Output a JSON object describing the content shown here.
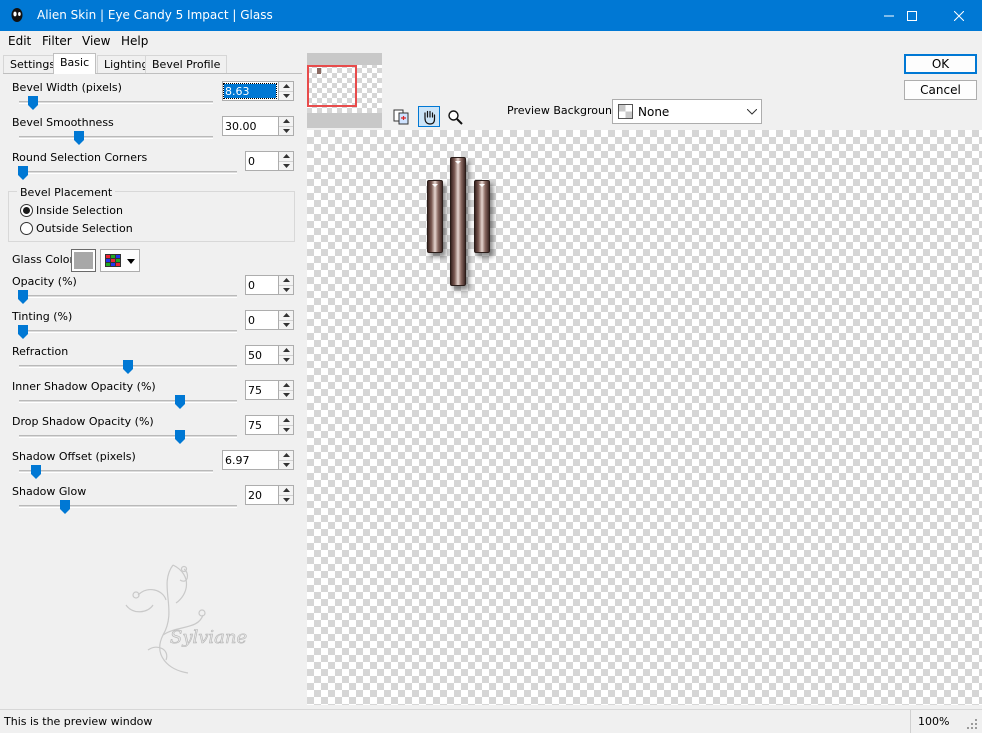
{
  "window": {
    "title": "Alien Skin | Eye Candy 5 Impact | Glass"
  },
  "menu": [
    "Edit",
    "Filter",
    "View",
    "Help"
  ],
  "tabs": [
    "Settings",
    "Basic",
    "Lighting",
    "Bevel Profile"
  ],
  "active_tab": "Basic",
  "controls": {
    "bevel_width": {
      "label": "Bevel Width (pixels)",
      "value": "8.63",
      "slider_fraction": 0.1
    },
    "bevel_smoothness": {
      "label": "Bevel Smoothness",
      "value": "30.00",
      "slider_fraction": 0.3
    },
    "round_corners": {
      "label": "Round Selection Corners",
      "value": "0",
      "slider_fraction": 0.0
    },
    "bevel_placement": {
      "label": "Bevel Placement",
      "options": [
        "Inside Selection",
        "Outside Selection"
      ],
      "selected": "Inside Selection"
    },
    "glass_color": {
      "label": "Glass Color",
      "color": "#a8a8a8"
    },
    "opacity": {
      "label": "Opacity (%)",
      "value": "0",
      "slider_fraction": 0.0
    },
    "tinting": {
      "label": "Tinting (%)",
      "value": "0",
      "slider_fraction": 0.0
    },
    "refraction": {
      "label": "Refraction",
      "value": "50",
      "slider_fraction": 0.5
    },
    "inner_shadow": {
      "label": "Inner Shadow Opacity (%)",
      "value": "75",
      "slider_fraction": 0.75
    },
    "drop_shadow": {
      "label": "Drop Shadow Opacity (%)",
      "value": "75",
      "slider_fraction": 0.75
    },
    "shadow_offset": {
      "label": "Shadow Offset (pixels)",
      "value": "6.97",
      "slider_fraction": 0.08
    },
    "shadow_glow": {
      "label": "Shadow Glow",
      "value": "20",
      "slider_fraction": 0.2
    }
  },
  "watermark": {
    "text": "Sylviane"
  },
  "preview_background": {
    "label": "Preview Background:",
    "value": "None"
  },
  "buttons": {
    "ok": "OK",
    "cancel": "Cancel"
  },
  "status": {
    "text": "This is the preview window",
    "zoom": "100%"
  },
  "colors": {
    "accent": "#0078d4",
    "panel": "#f0f0f0"
  }
}
